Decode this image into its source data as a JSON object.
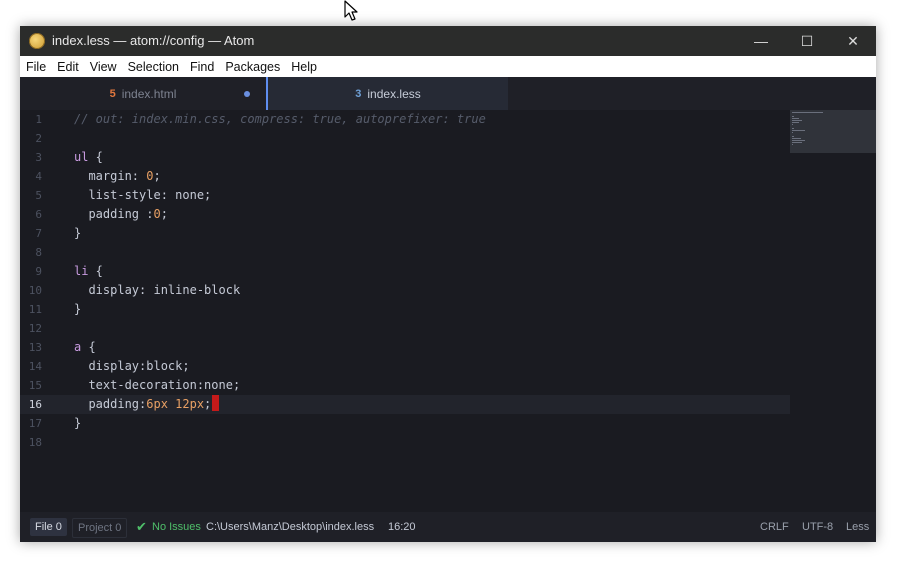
{
  "window": {
    "title": "index.less — atom://config — Atom",
    "controls": {
      "minimize": "—",
      "maximize": "☐",
      "close": "✕"
    }
  },
  "menu": [
    "File",
    "Edit",
    "View",
    "Selection",
    "Find",
    "Packages",
    "Help"
  ],
  "tabs": [
    {
      "label": "index.html",
      "icon": "html5-icon",
      "modified": true,
      "active": false
    },
    {
      "label": "index.less",
      "icon": "css3-icon",
      "modified": false,
      "active": true
    }
  ],
  "editor": {
    "current_line": 16,
    "line_numbers": [
      "1",
      "2",
      "3",
      "4",
      "5",
      "6",
      "7",
      "8",
      "9",
      "10",
      "11",
      "12",
      "13",
      "14",
      "15",
      "16",
      "17",
      "18"
    ],
    "lines": [
      [
        {
          "t": "comment",
          "v": "// out: index.min.css, compress: true, autoprefixer: true"
        }
      ],
      [],
      [
        {
          "t": "selector",
          "v": "ul"
        },
        {
          "t": "prop",
          "v": " {"
        }
      ],
      [
        {
          "t": "prop",
          "v": "  margin: "
        },
        {
          "t": "num",
          "v": "0"
        },
        {
          "t": "prop",
          "v": ";"
        }
      ],
      [
        {
          "t": "prop",
          "v": "  list-style: none;"
        }
      ],
      [
        {
          "t": "prop",
          "v": "  padding :"
        },
        {
          "t": "num",
          "v": "0"
        },
        {
          "t": "prop",
          "v": ";"
        }
      ],
      [
        {
          "t": "prop",
          "v": "}"
        }
      ],
      [],
      [
        {
          "t": "selector",
          "v": "li"
        },
        {
          "t": "prop",
          "v": " {"
        }
      ],
      [
        {
          "t": "prop",
          "v": "  display: inline-block"
        }
      ],
      [
        {
          "t": "prop",
          "v": "}"
        }
      ],
      [],
      [
        {
          "t": "selector",
          "v": "a"
        },
        {
          "t": "prop",
          "v": " {"
        }
      ],
      [
        {
          "t": "prop",
          "v": "  display:block;"
        }
      ],
      [
        {
          "t": "prop",
          "v": "  text-decoration:none;"
        }
      ],
      [
        {
          "t": "prop",
          "v": "  padding:"
        },
        {
          "t": "num",
          "v": "6px 12px"
        },
        {
          "t": "prop",
          "v": ";"
        }
      ],
      [
        {
          "t": "prop",
          "v": "}"
        }
      ],
      []
    ]
  },
  "status": {
    "file_tab": "File 0",
    "project_tab": "Project 0",
    "check_icon": "✔",
    "issues": "No Issues",
    "path": "C:\\Users\\Manz\\Desktop\\index.less",
    "cursor": "16:20",
    "line_ending": "CRLF",
    "encoding": "UTF-8",
    "grammar": "Less"
  },
  "colors": {
    "accent": "#5f8ef0",
    "ok": "#4fbf6a",
    "caret": "#c41a1a"
  }
}
